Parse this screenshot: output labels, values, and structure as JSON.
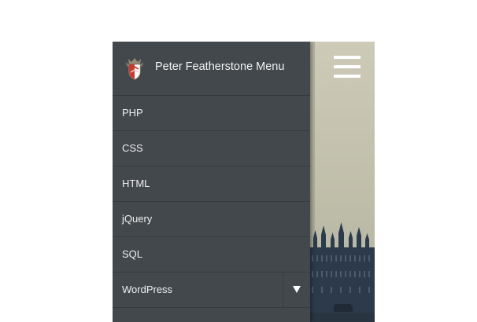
{
  "brand": {
    "title": "Peter Featherstone Menu",
    "logo_icon": "crest-shield-icon"
  },
  "menu": {
    "items": [
      {
        "label": "PHP"
      },
      {
        "label": "CSS"
      },
      {
        "label": "HTML"
      },
      {
        "label": "jQuery"
      },
      {
        "label": "SQL"
      },
      {
        "label": "WordPress",
        "has_submenu": true,
        "submenu_icon": "caret-down-icon"
      }
    ]
  },
  "hamburger": {
    "icon": "hamburger-menu-icon"
  },
  "colors": {
    "drawer_background": "#43484c",
    "divider": "#363b3e",
    "text": "#f0f0f0",
    "page_background": "#ffffff"
  }
}
